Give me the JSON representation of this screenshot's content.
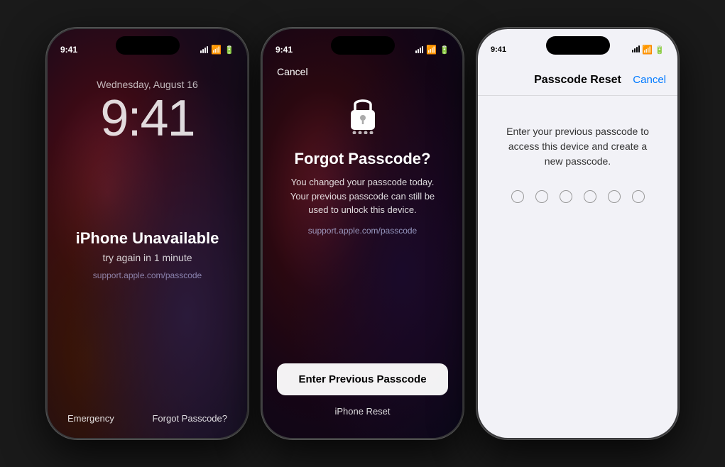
{
  "phone1": {
    "date": "Wednesday, August 16",
    "time": "9:41",
    "status_time": "9:41",
    "unavailable": "iPhone Unavailable",
    "retry": "try again in 1 minute",
    "support_link": "support.apple.com/passcode",
    "emergency": "Emergency",
    "forgot": "Forgot Passcode?"
  },
  "phone2": {
    "status_time": "9:41",
    "cancel": "Cancel",
    "title": "Forgot Passcode?",
    "description": "You changed your passcode today. Your previous passcode can still be used to unlock this device.",
    "support_link": "support.apple.com/passcode",
    "button": "Enter Previous Passcode",
    "reset": "iPhone Reset"
  },
  "phone3": {
    "status_time": "9:41",
    "header_title": "Passcode Reset",
    "cancel": "Cancel",
    "description": "Enter your previous passcode to access this device and create a new passcode.",
    "dot_count": 6
  },
  "colors": {
    "ios_blue": "#007aff",
    "ios_teal": "#32ade6"
  }
}
